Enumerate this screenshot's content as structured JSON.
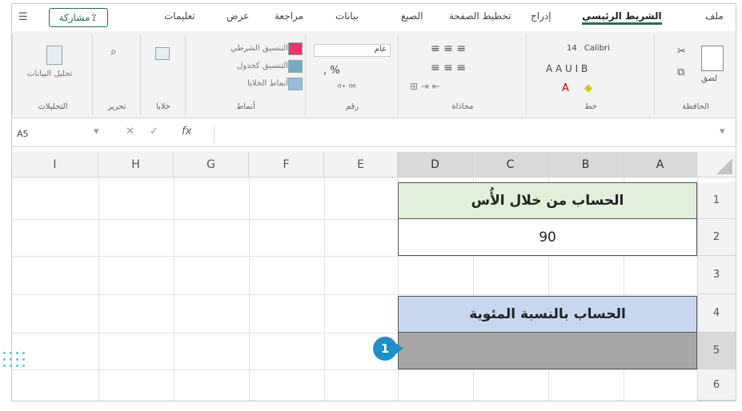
{
  "tabs": {
    "file": "ملف",
    "home": "الشريط الرئيسي",
    "insert": "إدراج",
    "page_layout": "تخطيط الصفحة",
    "formulas": "الصيغ",
    "data": "بيانات",
    "review": "مراجعة",
    "view": "عرض",
    "help": "تعليمات",
    "share": "مشاركة"
  },
  "ribbon": {
    "clipboard_label": "الحافظة",
    "font_label": "خط",
    "alignment_label": "محاذاة",
    "number_label": "رقم",
    "styles_label": "أنماط",
    "editing_label": "تحرير",
    "analysis_label": "التحليلات",
    "paste_label": "لصق",
    "font_name": "Calibri",
    "font_size": "14",
    "number_format": "عام",
    "conditional_formatting": "التنسيق الشرطي",
    "format_as_table": "التنسيق كجدول",
    "cell_styles": "أنماط الخلايا",
    "cells_label": "خلايا",
    "data_analysis": "تحليل البيانات"
  },
  "formula_bar": {
    "name_box": "A5",
    "fx": "fx",
    "content": ""
  },
  "grid": {
    "columns": [
      "I",
      "H",
      "G",
      "F",
      "E",
      "D",
      "C",
      "B",
      "A"
    ],
    "rows": [
      "1",
      "2",
      "3",
      "4",
      "5",
      "6"
    ],
    "cells": {
      "r1": "الحساب من خلال الأُس",
      "r2": "90",
      "r4": "الحساب بالنسبة المئوية",
      "r5": ""
    }
  },
  "callout": {
    "number": "1"
  },
  "colors": {
    "accent": "#217346",
    "header_green": "#e2efda",
    "header_blue": "#c9d6ef",
    "selected_cell": "#a6a6a6",
    "callout": "#1f8fc7"
  }
}
